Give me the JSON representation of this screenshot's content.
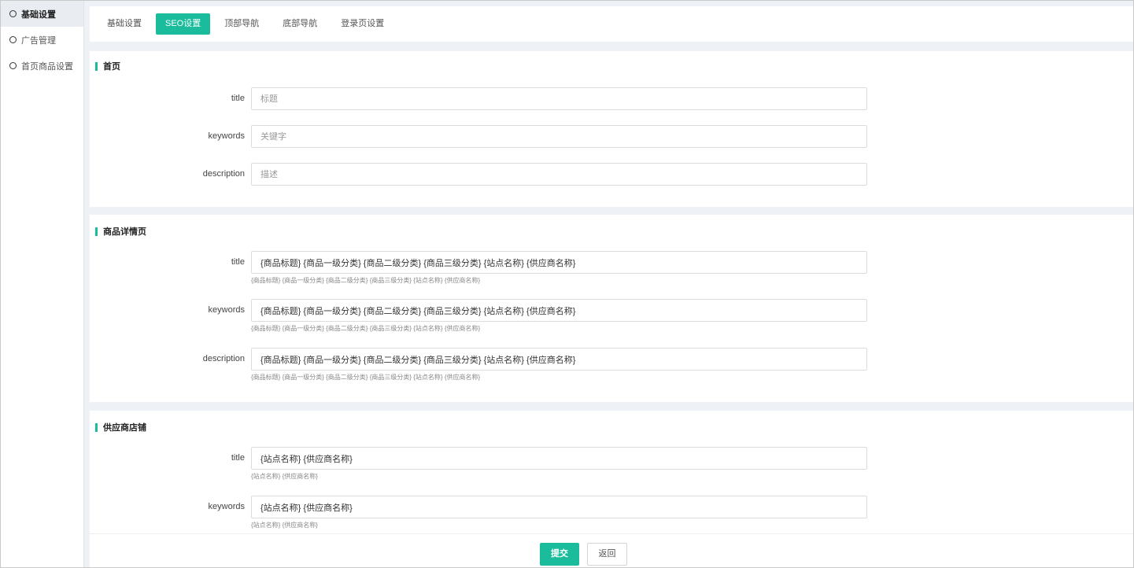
{
  "sidebar": {
    "items": [
      {
        "label": "基础设置",
        "active": true
      },
      {
        "label": "广告管理",
        "active": false
      },
      {
        "label": "首页商品设置",
        "active": false
      }
    ]
  },
  "tabs": [
    {
      "label": "基础设置",
      "active": false
    },
    {
      "label": "SEO设置",
      "active": true
    },
    {
      "label": "顶部导航",
      "active": false
    },
    {
      "label": "底部导航",
      "active": false
    },
    {
      "label": "登录页设置",
      "active": false
    }
  ],
  "sections": {
    "home": {
      "title": "首页",
      "title_label": "title",
      "title_placeholder": "标题",
      "keywords_label": "keywords",
      "keywords_placeholder": "关键字",
      "description_label": "description",
      "description_placeholder": "描述"
    },
    "product": {
      "title": "商品详情页",
      "title_label": "title",
      "title_value": "{商品标题} {商品一级分类} {商品二级分类} {商品三级分类} {站点名称} {供应商名称}",
      "title_hint": "{商品标题} {商品一级分类} {商品二级分类} {商品三级分类} {站点名称} {供应商名称}",
      "keywords_label": "keywords",
      "keywords_value": "{商品标题} {商品一级分类} {商品二级分类} {商品三级分类} {站点名称} {供应商名称}",
      "keywords_hint": "{商品标题} {商品一级分类} {商品二级分类} {商品三级分类} {站点名称} {供应商名称}",
      "description_label": "description",
      "description_value": "{商品标题} {商品一级分类} {商品二级分类} {商品三级分类} {站点名称} {供应商名称}",
      "description_hint": "{商品标题} {商品一级分类} {商品二级分类} {商品三级分类} {站点名称} {供应商名称}"
    },
    "supplier": {
      "title": "供应商店铺",
      "title_label": "title",
      "title_value": "{站点名称} {供应商名称}",
      "title_hint": "{站点名称} {供应商名称}",
      "keywords_label": "keywords",
      "keywords_value": "{站点名称} {供应商名称}",
      "keywords_hint": "{站点名称} {供应商名称}"
    }
  },
  "footer": {
    "submit_label": "提交",
    "back_label": "返回"
  },
  "colors": {
    "accent": "#1abc9c"
  }
}
